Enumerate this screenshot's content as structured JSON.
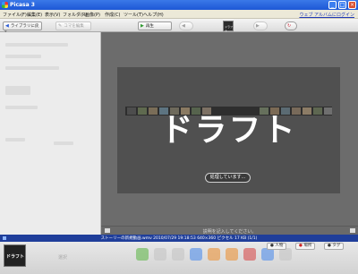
{
  "window": {
    "title": "Picasa 3"
  },
  "menu": {
    "items": [
      "ファイル(F)",
      "編集(E)",
      "表示(V)",
      "フォルダ(R)",
      "画像(P)",
      "作成(C)",
      "ツール(T)",
      "ヘルプ(H)"
    ],
    "help_link": "ウェブ アルバムにログイン"
  },
  "toolbar": {
    "back_label": "ライブラリに戻る",
    "edit_label": "コマを編集",
    "play_label": "再生",
    "thumb_label": "ドラフト"
  },
  "viewer": {
    "overlay_text": "ドラフト",
    "processing_label": "処理しています..."
  },
  "caption": {
    "placeholder": "説明を記入してください。"
  },
  "status": {
    "text": "ストーリーの新規動画.wmv 2010/07/29 19:18:53 640×360 ピクセル 17 KB    (1/1)"
  },
  "tray": {
    "thumb_text": "ドラフト",
    "label": "選択",
    "people_label": "人物",
    "places_label": "場所",
    "tags_label": "タグ"
  },
  "colors": {
    "titlebar": "#1d57d6",
    "statusbar": "#1f3e9a",
    "viewer": "#6c6c6c",
    "card": "#505050"
  }
}
